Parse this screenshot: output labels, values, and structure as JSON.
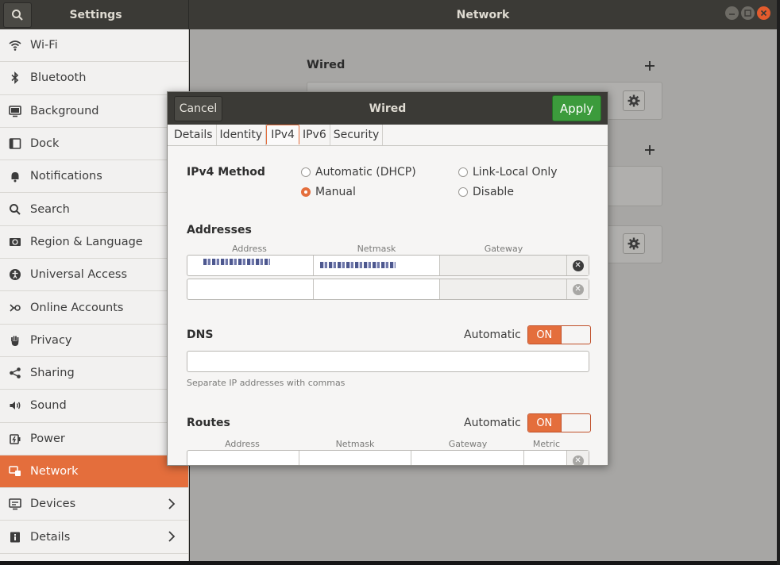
{
  "titlebar": {
    "left_title": "Settings",
    "right_title": "Network"
  },
  "sidebar": {
    "items": [
      {
        "label": "Wi-Fi",
        "icon": "wifi-icon"
      },
      {
        "label": "Bluetooth",
        "icon": "bluetooth-icon"
      },
      {
        "label": "Background",
        "icon": "background-icon"
      },
      {
        "label": "Dock",
        "icon": "dock-icon"
      },
      {
        "label": "Notifications",
        "icon": "bell-icon"
      },
      {
        "label": "Search",
        "icon": "search-icon"
      },
      {
        "label": "Region & Language",
        "icon": "region-icon"
      },
      {
        "label": "Universal Access",
        "icon": "accessibility-icon"
      },
      {
        "label": "Online Accounts",
        "icon": "online-accounts-icon"
      },
      {
        "label": "Privacy",
        "icon": "hand-icon"
      },
      {
        "label": "Sharing",
        "icon": "share-icon"
      },
      {
        "label": "Sound",
        "icon": "speaker-icon"
      },
      {
        "label": "Power",
        "icon": "power-icon"
      },
      {
        "label": "Network",
        "icon": "network-icon",
        "active": true
      },
      {
        "label": "Devices",
        "icon": "devices-icon",
        "chevron": true
      },
      {
        "label": "Details",
        "icon": "info-icon",
        "chevron": true
      }
    ]
  },
  "main": {
    "wired_section": "Wired"
  },
  "dialog": {
    "title": "Wired",
    "cancel_label": "Cancel",
    "apply_label": "Apply",
    "tabs": [
      "Details",
      "Identity",
      "IPv4",
      "IPv6",
      "Security"
    ],
    "active_tab": "IPv4",
    "ipv4_method": {
      "label": "IPv4 Method",
      "options": [
        {
          "label": "Automatic (DHCP)",
          "checked": false
        },
        {
          "label": "Link-Local Only",
          "checked": false
        },
        {
          "label": "Manual",
          "checked": true
        },
        {
          "label": "Disable",
          "checked": false
        }
      ]
    },
    "addresses": {
      "label": "Addresses",
      "columns": [
        "Address",
        "Netmask",
        "Gateway"
      ]
    },
    "dns": {
      "label": "DNS",
      "automatic_label": "Automatic",
      "switch_label": "ON",
      "hint": "Separate IP addresses with commas"
    },
    "routes": {
      "label": "Routes",
      "automatic_label": "Automatic",
      "switch_label": "ON",
      "columns": [
        "Address",
        "Netmask",
        "Gateway",
        "Metric"
      ]
    }
  },
  "colors": {
    "accent": "#e46e3c",
    "apply_green": "#3c9b3c",
    "titlebar": "#3b3a36"
  }
}
